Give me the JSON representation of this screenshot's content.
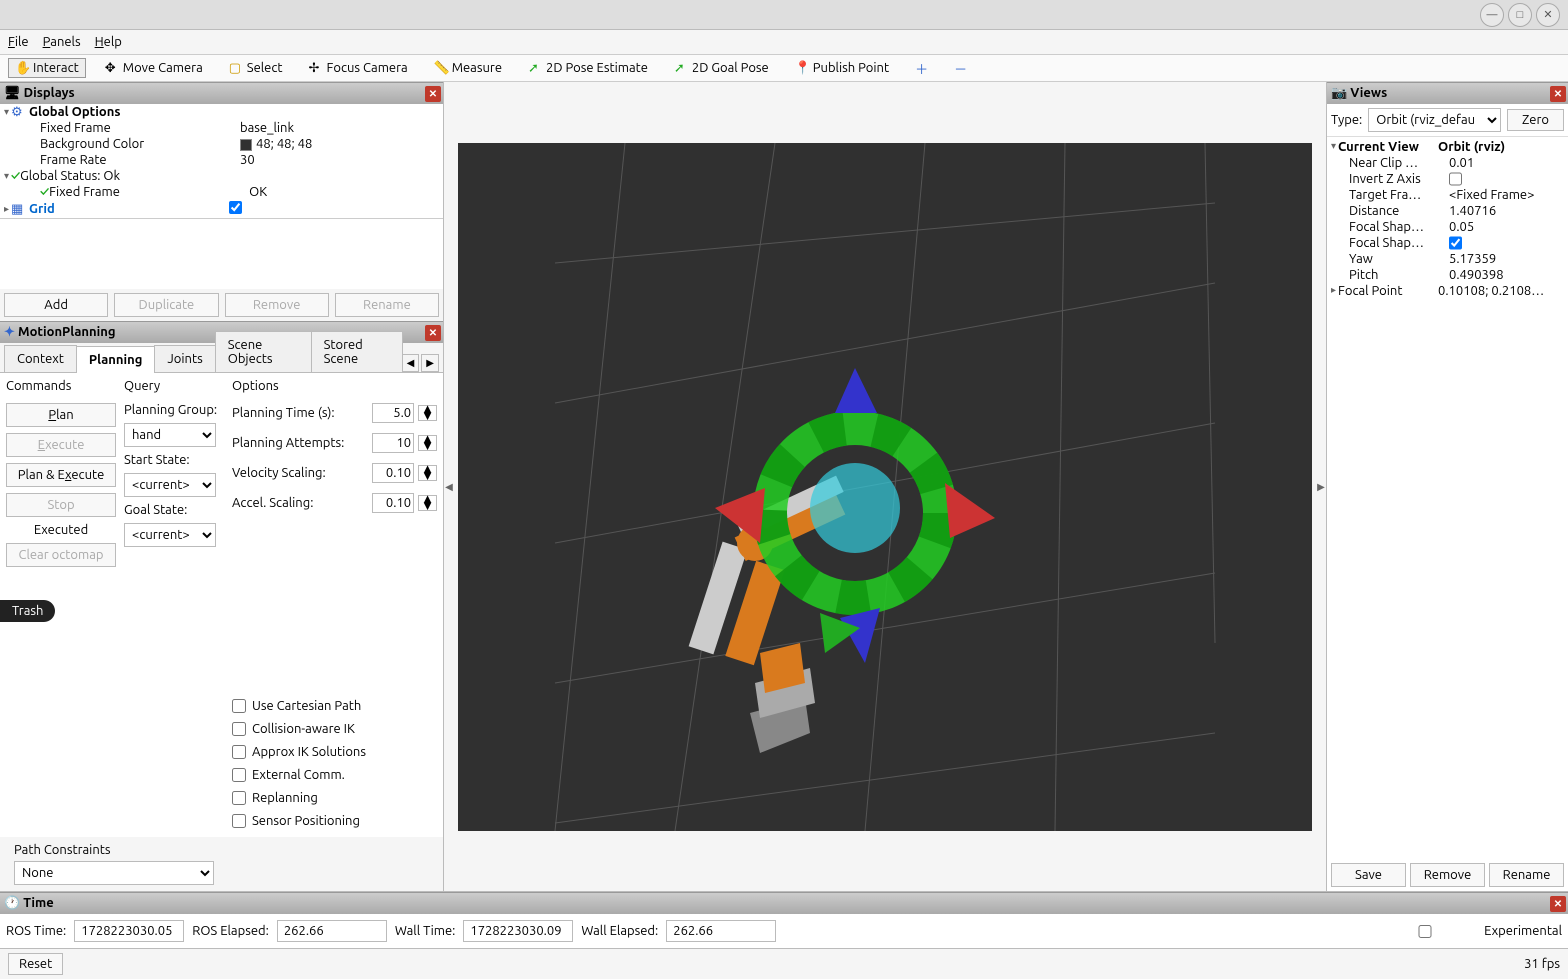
{
  "menubar": {
    "file": "File",
    "panels": "Panels",
    "help": "Help"
  },
  "toolbar": {
    "interact": "Interact",
    "move_camera": "Move Camera",
    "select": "Select",
    "focus_camera": "Focus Camera",
    "measure": "Measure",
    "pose_estimate": "2D Pose Estimate",
    "goal_pose": "2D Goal Pose",
    "publish_point": "Publish Point"
  },
  "displays": {
    "title": "Displays",
    "global_options": "Global Options",
    "fixed_frame_label": "Fixed Frame",
    "fixed_frame_val": "base_link",
    "bg_color_label": "Background Color",
    "bg_color_val": "48; 48; 48",
    "frame_rate_label": "Frame Rate",
    "frame_rate_val": "30",
    "global_status": "Global Status: Ok",
    "fixed_frame_status_label": "Fixed Frame",
    "fixed_frame_status_val": "OK",
    "grid": "Grid",
    "btn_add": "Add",
    "btn_duplicate": "Duplicate",
    "btn_remove": "Remove",
    "btn_rename": "Rename"
  },
  "motion": {
    "title": "MotionPlanning",
    "tabs": {
      "context": "Context",
      "planning": "Planning",
      "joints": "Joints",
      "scene_objects": "Scene Objects",
      "stored_scene": "Stored Scene"
    },
    "commands_h": "Commands",
    "query_h": "Query",
    "options_h": "Options",
    "plan": "Plan",
    "execute": "Execute",
    "plan_execute": "Plan & Execute",
    "stop": "Stop",
    "executed": "Executed",
    "clear_octomap": "Clear octomap",
    "planning_group": "Planning Group:",
    "planning_group_val": "hand",
    "start_state": "Start State:",
    "start_state_val": "<current>",
    "goal_state": "Goal State:",
    "goal_state_val": "<current>",
    "planning_time": "Planning Time (s):",
    "planning_time_val": "5.0",
    "planning_attempts": "Planning Attempts:",
    "planning_attempts_val": "10",
    "velocity_scaling": "Velocity Scaling:",
    "velocity_scaling_val": "0.10",
    "accel_scaling": "Accel. Scaling:",
    "accel_scaling_val": "0.10",
    "use_cartesian": "Use Cartesian Path",
    "collision_ik": "Collision-aware IK",
    "approx_ik": "Approx IK Solutions",
    "external_comm": "External Comm.",
    "replanning": "Replanning",
    "sensor_pos": "Sensor Positioning",
    "path_constraints": "Path Constraints",
    "path_constraints_val": "None"
  },
  "trash": "Trash",
  "views": {
    "title": "Views",
    "type_label": "Type:",
    "type_val": "Orbit (rviz_defau",
    "zero": "Zero",
    "current_view": "Current View",
    "current_view_val": "Orbit (rviz)",
    "near_clip": "Near Clip …",
    "near_clip_val": "0.01",
    "invert_z": "Invert Z Axis",
    "target_frame": "Target Fra…",
    "target_frame_val": "<Fixed Frame>",
    "distance": "Distance",
    "distance_val": "1.40716",
    "focal_shape1": "Focal Shap…",
    "focal_shape1_val": "0.05",
    "focal_shape2": "Focal Shap…",
    "yaw": "Yaw",
    "yaw_val": "5.17359",
    "pitch": "Pitch",
    "pitch_val": "0.490398",
    "focal_point": "Focal Point",
    "focal_point_val": "0.10108; 0.2108…",
    "save": "Save",
    "remove": "Remove",
    "rename": "Rename"
  },
  "time": {
    "title": "Time",
    "ros_time": "ROS Time:",
    "ros_time_val": "1728223030.05",
    "ros_elapsed": "ROS Elapsed:",
    "ros_elapsed_val": "262.66",
    "wall_time": "Wall Time:",
    "wall_time_val": "1728223030.09",
    "wall_elapsed": "Wall Elapsed:",
    "wall_elapsed_val": "262.66",
    "experimental": "Experimental"
  },
  "bottom": {
    "reset": "Reset",
    "fps": "31 fps"
  }
}
